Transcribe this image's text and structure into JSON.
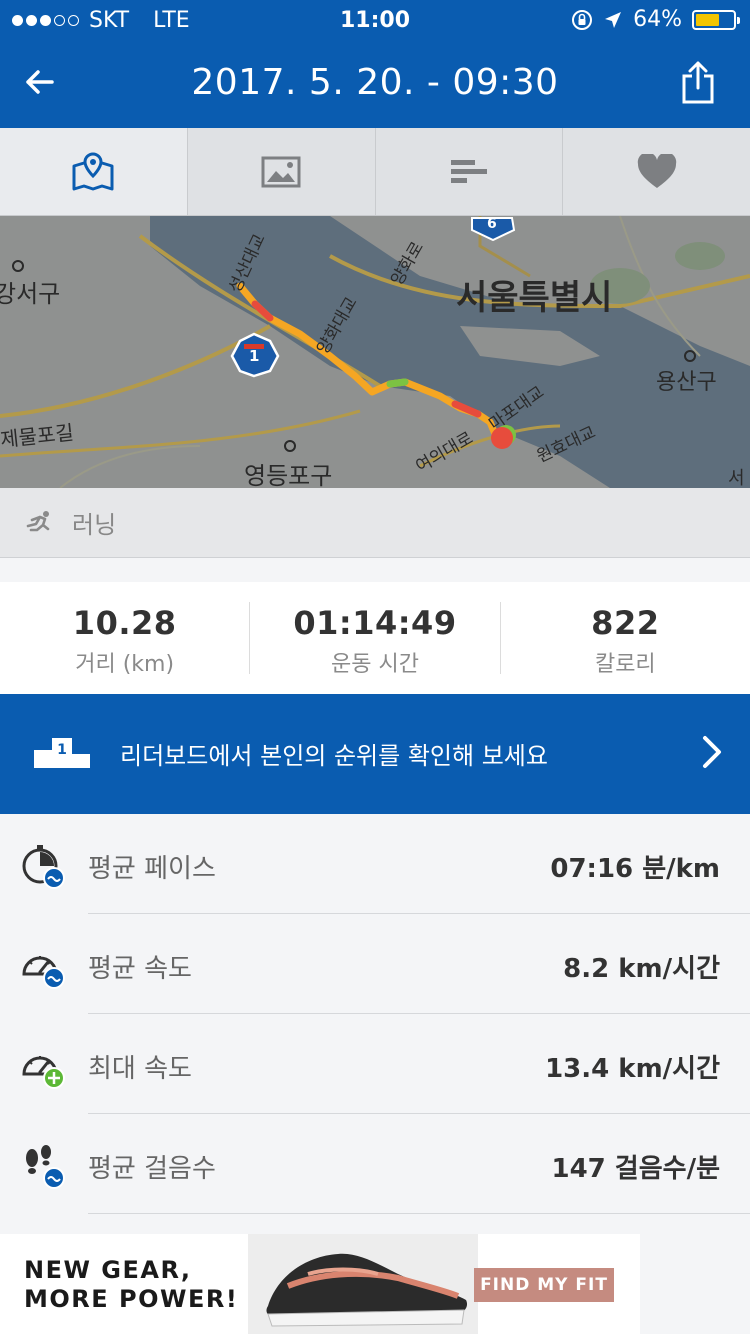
{
  "status_bar": {
    "carrier": "SKT",
    "network": "LTE",
    "time": "11:00",
    "battery": "64%",
    "battery_level": 0.64,
    "signal_bars_filled": 3,
    "signal_bars_total": 5
  },
  "header": {
    "title": "2017. 5. 20. - 09:30",
    "back_icon": "arrow-left-icon",
    "share_icon": "share-icon"
  },
  "tabs": [
    {
      "icon": "map-icon",
      "active": true
    },
    {
      "icon": "image-icon",
      "active": false
    },
    {
      "icon": "bar-list-icon",
      "active": false
    },
    {
      "icon": "heart-icon",
      "active": false
    }
  ],
  "map": {
    "labels": [
      "강서구",
      "서울특별시",
      "용산구",
      "제물포길",
      "영등포구",
      "양화대교",
      "양화로",
      "성산대교",
      "마포대교",
      "원효대교",
      "여의대로",
      "서"
    ],
    "highway_badges": [
      "6",
      "1"
    ]
  },
  "activity": {
    "type": "러닝",
    "icon": "running-icon"
  },
  "summary": [
    {
      "value": "10.28",
      "label": "거리 (km)"
    },
    {
      "value": "01:14:49",
      "label": "운동 시간"
    },
    {
      "value": "822",
      "label": "칼로리"
    }
  ],
  "leaderboard": {
    "text": "리더보드에서 본인의 순위를 확인해 보세요",
    "podium_number": "1"
  },
  "metrics": [
    {
      "name": "평균 페이스",
      "value": "07:16 분/km",
      "icon": "stopwatch-avg-icon"
    },
    {
      "name": "평균 속도",
      "value": "8.2 km/시간",
      "icon": "speedometer-avg-icon"
    },
    {
      "name": "최대 속도",
      "value": "13.4 km/시간",
      "icon": "speedometer-max-icon"
    },
    {
      "name": "평균 걸음수",
      "value": "147 걸음수/분",
      "icon": "footsteps-avg-icon"
    }
  ],
  "ad": {
    "line1": "NEW GEAR,",
    "line2": "MORE POWER!",
    "cta": "FIND MY FIT"
  },
  "colors": {
    "brand_blue": "#0a5cb0",
    "route_start": "#f5a623",
    "route_end": "#e74c3c"
  }
}
